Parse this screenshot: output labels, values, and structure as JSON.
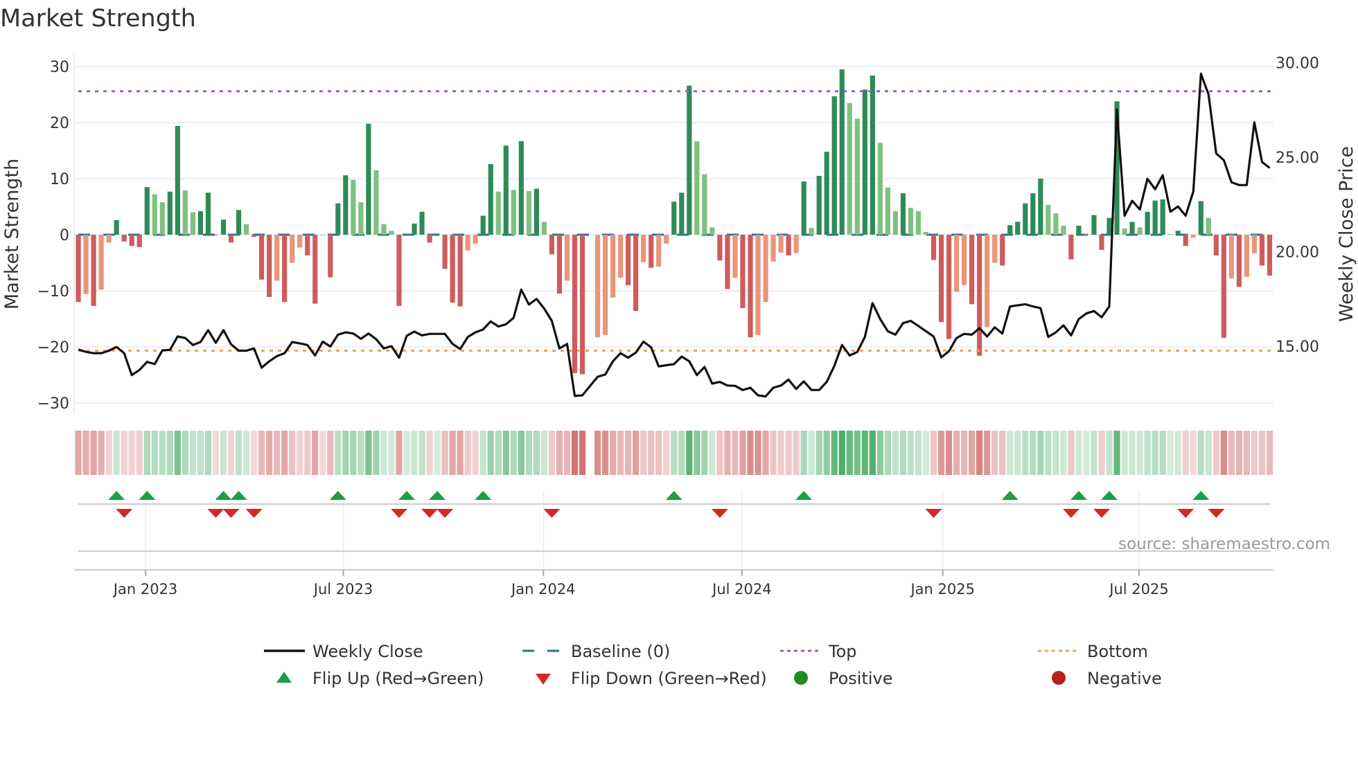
{
  "chart_data": {
    "type": "bar",
    "title": "Market Strength",
    "ylabel": "Market Strength",
    "y2label": "Weekly Close Price",
    "source": "source: sharemaestro.com",
    "ylim": [
      -32,
      32
    ],
    "y2lim": [
      11.41,
      30.38
    ],
    "xlim_weeks": [
      -0.55,
      156.5
    ],
    "top_level": 25.6,
    "bottom_level": -20.7,
    "left_axis": {
      "values": [
        30,
        20,
        10,
        0,
        -10,
        -20,
        -30
      ],
      "ticks": [
        "30",
        "20",
        "10",
        "0",
        "−10",
        "−20",
        "−30"
      ]
    },
    "right_axis": {
      "values": [
        30,
        25,
        20,
        15
      ],
      "ticks": [
        "30.00",
        "25.00",
        "20.00",
        "15.00"
      ]
    },
    "x_ticks": [
      {
        "label": "Jan 2023",
        "week": 8.8
      },
      {
        "label": "Jul 2023",
        "week": 34.7
      },
      {
        "label": "Jan 2024",
        "week": 60.9
      },
      {
        "label": "Jul 2024",
        "week": 86.9
      },
      {
        "label": "Jan 2025",
        "week": 113.2
      },
      {
        "label": "Jul 2025",
        "week": 138.9
      }
    ],
    "strength": [
      -12.0,
      -10.6,
      -12.7,
      -9.8,
      -1.4,
      2.6,
      -1.2,
      -2.0,
      -2.2,
      8.5,
      7.2,
      5.8,
      7.7,
      19.4,
      7.9,
      4.0,
      4.2,
      7.5,
      -0.1,
      2.7,
      -1.4,
      4.4,
      1.9,
      -0.4,
      -8.0,
      -11.1,
      -8.2,
      -12.0,
      -5.0,
      -2.3,
      -3.7,
      -12.3,
      -0.1,
      -7.6,
      5.6,
      10.6,
      9.8,
      5.8,
      19.8,
      11.5,
      1.9,
      0.7,
      -12.7,
      0.1,
      2.0,
      4.1,
      -1.4,
      0.2,
      -6.1,
      -12.1,
      -12.8,
      -2.8,
      -1.6,
      3.4,
      12.6,
      7.7,
      15.9,
      8.0,
      16.7,
      7.8,
      8.2,
      2.3,
      -3.5,
      -10.5,
      -8.2,
      -24.7,
      -24.9,
      null,
      -18.3,
      -17.9,
      -11.2,
      -7.7,
      -9.0,
      -13.6,
      -4.9,
      -5.9,
      -5.7,
      -1.6,
      5.9,
      7.5,
      26.6,
      16.7,
      10.8,
      1.3,
      -4.6,
      -9.7,
      -7.7,
      -13.1,
      -18.3,
      -17.9,
      -12.0,
      -4.8,
      -3.2,
      -3.7,
      -3.3,
      9.5,
      1.2,
      10.5,
      14.8,
      24.7,
      29.5,
      23.5,
      20.7,
      25.9,
      28.4,
      16.4,
      8.4,
      4.2,
      7.4,
      4.8,
      4.2,
      0.5,
      -4.5,
      -15.6,
      -18.6,
      -10.2,
      -9.0,
      -12.4,
      -21.6,
      -16.5,
      -5.0,
      -5.5,
      1.7,
      2.3,
      5.6,
      7.4,
      10.0,
      5.3,
      3.8,
      1.6,
      -4.4,
      1.6,
      0.1,
      3.5,
      -2.7,
      3.0,
      23.8,
      1.1,
      2.3,
      1.3,
      4.1,
      6.1,
      6.3,
      0.1,
      0.7,
      -2.0,
      -0.5,
      6.0,
      3.0,
      -3.7,
      -18.4,
      -7.8,
      -9.3,
      -7.5,
      -3.3,
      -5.5,
      -7.3
    ],
    "weekly_close": [
      14.82,
      14.7,
      14.63,
      14.63,
      14.76,
      14.96,
      14.63,
      13.47,
      13.74,
      14.17,
      14.05,
      14.78,
      14.8,
      15.51,
      15.43,
      15.06,
      15.22,
      15.85,
      15.18,
      15.85,
      15.1,
      14.76,
      14.76,
      14.88,
      13.86,
      14.2,
      14.47,
      14.63,
      15.22,
      15.15,
      15.06,
      14.51,
      15.24,
      14.98,
      15.61,
      15.73,
      15.67,
      15.39,
      15.67,
      15.37,
      14.88,
      15.0,
      14.39,
      15.55,
      15.77,
      15.57,
      15.65,
      15.65,
      15.65,
      15.12,
      14.85,
      15.49,
      15.73,
      15.88,
      16.31,
      16.04,
      16.16,
      16.5,
      17.99,
      17.2,
      17.5,
      16.99,
      16.34,
      14.88,
      15.12,
      12.37,
      12.4,
      12.89,
      13.38,
      13.5,
      14.2,
      14.63,
      14.39,
      14.66,
      15.24,
      14.94,
      13.93,
      13.99,
      14.05,
      14.45,
      14.2,
      13.47,
      13.9,
      13.02,
      13.11,
      12.92,
      12.9,
      12.68,
      12.8,
      12.4,
      12.34,
      12.8,
      12.92,
      13.23,
      12.74,
      13.14,
      12.68,
      12.68,
      13.11,
      13.96,
      15.06,
      14.51,
      14.69,
      15.49,
      17.28,
      16.43,
      15.79,
      15.61,
      16.22,
      16.34,
      16.07,
      15.79,
      15.51,
      14.41,
      14.73,
      15.43,
      15.65,
      15.61,
      15.95,
      15.51,
      16.0,
      15.67,
      17.1,
      17.16,
      17.22,
      17.1,
      17.01,
      15.49,
      15.73,
      16.1,
      15.57,
      16.43,
      16.73,
      16.86,
      16.53,
      17.1,
      27.52,
      21.9,
      22.69,
      22.23,
      23.85,
      23.3,
      24.04,
      22.11,
      22.39,
      21.9,
      23.18,
      29.41,
      28.31,
      25.2,
      24.83,
      23.67,
      23.52,
      23.52,
      26.84,
      24.74,
      24.43
    ],
    "colors": {
      "pos_rising": "#2e8b57",
      "pos_falling": "#80c080",
      "neg_falling": "#cd5c5c",
      "neg_rising": "#e9967a",
      "line": "#111111",
      "baseline": "#2a6f97",
      "top": "#9b59d6",
      "bottom": "#f0a35e",
      "flip_up": "#1a9e4a",
      "flip_down": "#d62728",
      "positive": "#228b22",
      "negative": "#b22222"
    },
    "legend": {
      "placement": "bottom",
      "weekly_close": "Weekly Close",
      "baseline": "Baseline (0)",
      "top": "Top",
      "bottom": "Bottom",
      "flip_up": "Flip Up (Red→Green)",
      "flip_down": "Flip Down (Green→Red)",
      "positive": "Positive",
      "negative": "Negative"
    }
  }
}
